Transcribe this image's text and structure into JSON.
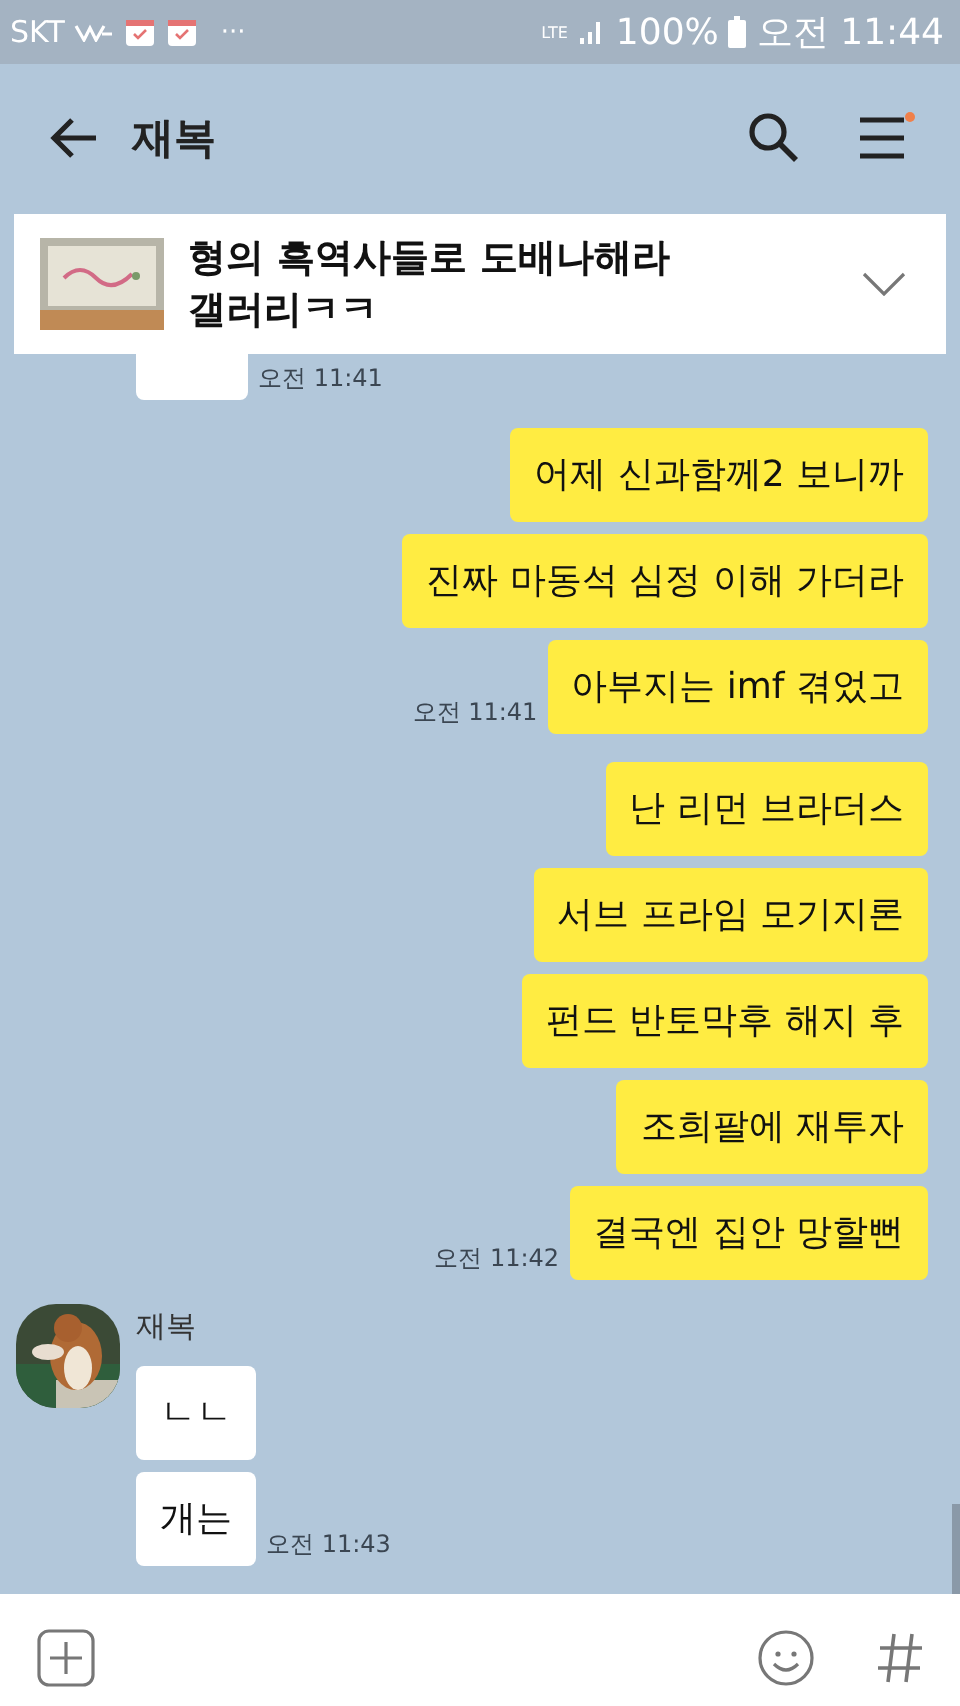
{
  "status_bar": {
    "carrier": "SKT",
    "more": "···",
    "network": "LTE",
    "battery": "100%",
    "time": "오전 11:44"
  },
  "header": {
    "title": "재복"
  },
  "notice": {
    "text": "형의 흑역사들로 도배나해라 갤러리ㅋㅋ",
    "thumbnail": {
      "kind": "picture"
    }
  },
  "groups": [
    {
      "kind": "cut_off",
      "time": "오전 11:41"
    },
    {
      "kind": "outgoing",
      "messages": [
        "어제 신과함께2 보니까",
        "진짜 마동석 심정 이해 가더라",
        "아부지는 imf 겪었고"
      ],
      "time": "오전 11:41"
    },
    {
      "kind": "outgoing",
      "messages": [
        "난 리먼 브라더스",
        "서브 프라임 모기지론",
        "펀드 반토막후 해지 후",
        "조희팔에 재투자",
        "결국엔 집안 망할뻔"
      ],
      "time": "오전 11:42"
    },
    {
      "kind": "incoming",
      "sender": "재복",
      "avatar": {
        "kind": "picture"
      },
      "messages": [
        "ㄴㄴ",
        "개는"
      ],
      "time": "오전 11:43"
    }
  ]
}
